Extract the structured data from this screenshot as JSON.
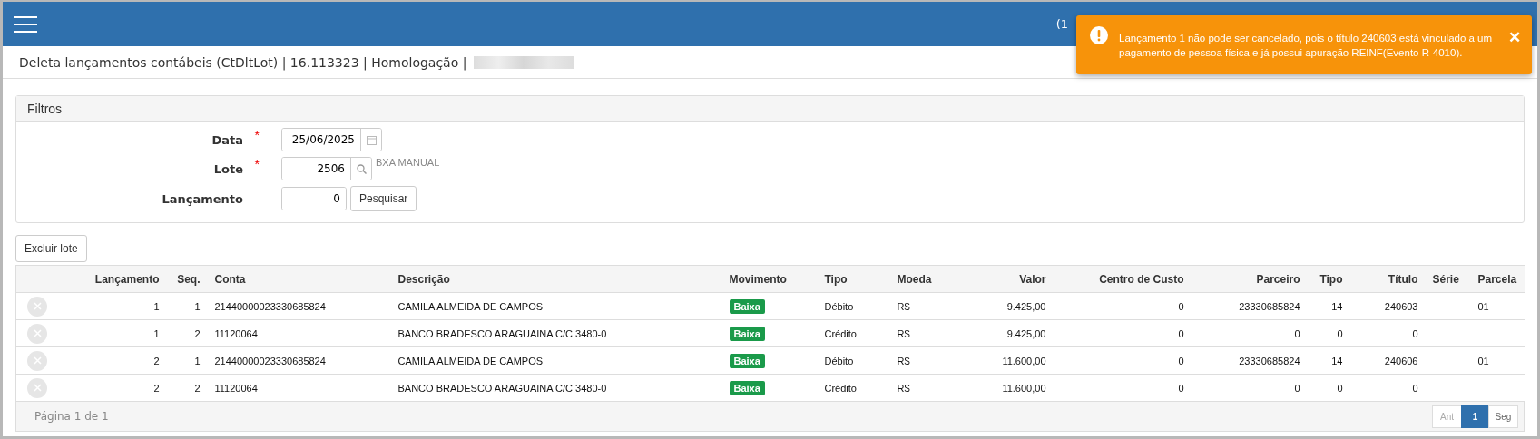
{
  "header": {
    "counter": "(1"
  },
  "toast": {
    "message": "Lançamento 1 não pode ser cancelado, pois o título 240603 está vinculado a um pagamento de pessoa física e já possui apuração REINF(Evento R-4010).",
    "close": "✕"
  },
  "page_title": "Deleta lançamentos contábeis (CtDltLot) | 16.113323 | Homologação |",
  "filters": {
    "title": "Filtros",
    "fields": [
      {
        "label": "Data",
        "required_mark": "*",
        "value": "25/06/2025",
        "kind": "date"
      },
      {
        "label": "Lote",
        "required_mark": "*",
        "value": "2506",
        "kind": "lookup",
        "description": "BXA MANUAL"
      },
      {
        "label": "Lançamento",
        "value": "0",
        "kind": "search",
        "button": "Pesquisar"
      }
    ]
  },
  "delete_batch_button": "Excluir lote",
  "table": {
    "columns": [
      "Lançamento",
      "Seq.",
      "Conta",
      "Descrição",
      "Movimento",
      "Tipo",
      "Moeda",
      "Valor",
      "Centro de Custo",
      "Parceiro",
      "Tipo",
      "Título",
      "Série",
      "Parcela"
    ],
    "rows": [
      {
        "cells": [
          "1",
          "1",
          "21440000023330685824",
          "CAMILA ALMEIDA DE CAMPOS",
          "Baixa",
          "Débito",
          "R$",
          "9.425,00",
          "0",
          "23330685824",
          "14",
          "240603",
          "",
          "01"
        ]
      },
      {
        "cells": [
          "1",
          "2",
          "11120064",
          "BANCO BRADESCO ARAGUAINA C/C 3480-0",
          "Baixa",
          "Crédito",
          "R$",
          "9.425,00",
          "0",
          "0",
          "0",
          "0",
          "",
          ""
        ]
      },
      {
        "cells": [
          "2",
          "1",
          "21440000023330685824",
          "CAMILA ALMEIDA DE CAMPOS",
          "Baixa",
          "Débito",
          "R$",
          "11.600,00",
          "0",
          "23330685824",
          "14",
          "240606",
          "",
          "01"
        ]
      },
      {
        "cells": [
          "2",
          "2",
          "11120064",
          "BANCO BRADESCO ARAGUAINA C/C 3480-0",
          "Baixa",
          "Crédito",
          "R$",
          "11.600,00",
          "0",
          "0",
          "0",
          "0",
          "",
          ""
        ]
      }
    ]
  },
  "footer": {
    "page_info": "Página 1 de 1",
    "pagination": [
      {
        "label": "Ant",
        "selected": false,
        "disabled": true
      },
      {
        "label": "1",
        "selected": true,
        "disabled": false
      },
      {
        "label": "Seg",
        "selected": false,
        "disabled": false
      }
    ]
  }
}
